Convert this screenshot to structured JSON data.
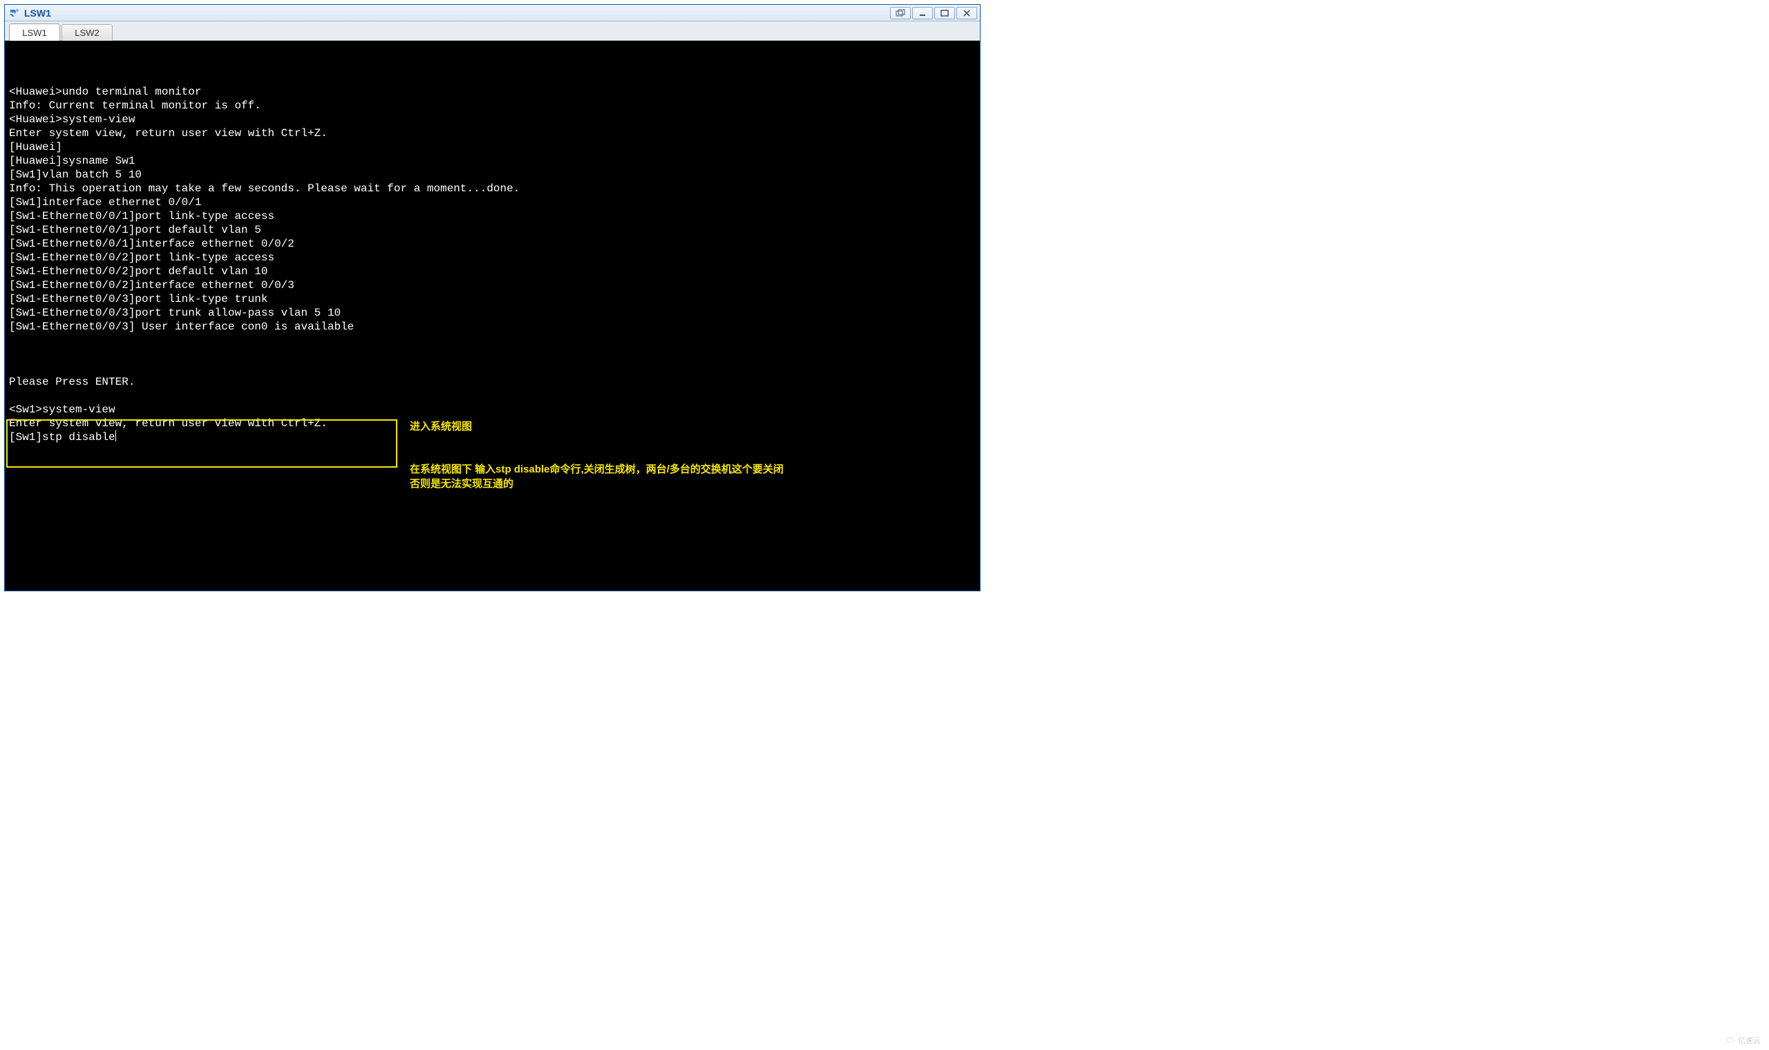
{
  "window": {
    "title": "LSW1",
    "app_icon_name": "ensp-icon"
  },
  "tabs": [
    {
      "label": "LSW1",
      "active": true
    },
    {
      "label": "LSW2",
      "active": false
    }
  ],
  "terminal_lines": [
    "<Huawei>undo terminal monitor",
    "Info: Current terminal monitor is off.",
    "<Huawei>system-view",
    "Enter system view, return user view with Ctrl+Z.",
    "[Huawei]",
    "[Huawei]sysname Sw1",
    "[Sw1]vlan batch 5 10",
    "Info: This operation may take a few seconds. Please wait for a moment...done.",
    "[Sw1]interface ethernet 0/0/1",
    "[Sw1-Ethernet0/0/1]port link-type access",
    "[Sw1-Ethernet0/0/1]port default vlan 5",
    "[Sw1-Ethernet0/0/1]interface ethernet 0/0/2",
    "[Sw1-Ethernet0/0/2]port link-type access",
    "[Sw1-Ethernet0/0/2]port default vlan 10",
    "[Sw1-Ethernet0/0/2]interface ethernet 0/0/3",
    "[Sw1-Ethernet0/0/3]port link-type trunk",
    "[Sw1-Ethernet0/0/3]port trunk allow-pass vlan 5 10",
    "[Sw1-Ethernet0/0/3] User interface con0 is available",
    "",
    "",
    "",
    "Please Press ENTER.",
    "",
    "<Sw1>system-view",
    "Enter system view, return user view with Ctrl+Z.",
    "[Sw1]stp disable"
  ],
  "cursor_after_last": true,
  "annotations": {
    "a1": "进入系统视图",
    "a2_line1": "在系统视图下 输入stp disable命令行,关闭生成树，两台/多台的交换机这个要关闭",
    "a2_line2": "否则是无法实现互通的"
  },
  "watermark": "亿速云",
  "colors": {
    "title_text": "#1354a4",
    "terminal_bg": "#000000",
    "terminal_fg": "#ffffff",
    "annot_yellow": "#f5e600"
  }
}
